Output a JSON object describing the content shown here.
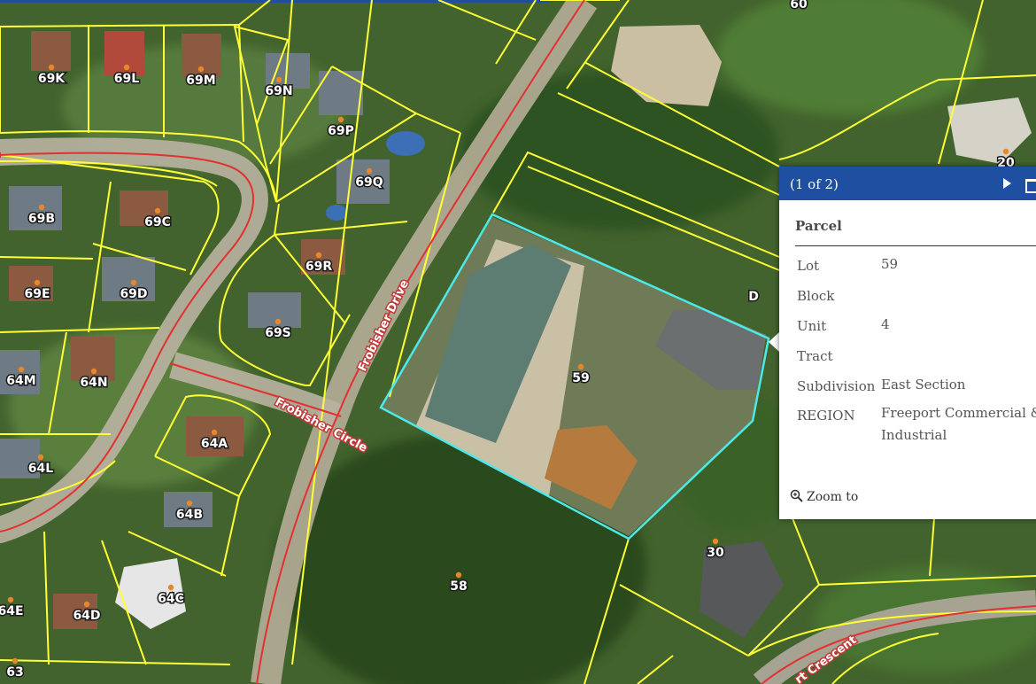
{
  "map": {
    "lot_labels": [
      "69K",
      "69L",
      "69M",
      "69N",
      "69P",
      "69Q",
      "69B",
      "69C",
      "69R",
      "69E",
      "69D",
      "69S",
      "64M",
      "64N",
      "59",
      "D",
      "64A",
      "64L",
      "64B",
      "58",
      "30",
      "64C",
      "64D",
      "64E",
      "63",
      "60",
      "20"
    ],
    "streets": [
      "Frobisher Drive",
      "Frobisher Circle",
      "rt Crescent"
    ],
    "colors": {
      "parcel_line": "#ffff33",
      "road_line": "#e33030",
      "selected_parcel": "#4de8e8",
      "header": "#1f4fa1"
    }
  },
  "popup": {
    "count": "(1 of 2)",
    "title": "Parcel",
    "next_icon": "play-right-icon",
    "maximize_icon": "maximize-icon",
    "attributes": [
      {
        "key": "Lot",
        "value": "59"
      },
      {
        "key": "Block",
        "value": ""
      },
      {
        "key": "Unit",
        "value": "4"
      },
      {
        "key": "Tract",
        "value": ""
      },
      {
        "key": "Subdivision",
        "value": "East Section"
      },
      {
        "key": "REGION",
        "value": "Freeport Commercial & Industrial"
      }
    ],
    "zoom_label": "Zoom to"
  }
}
